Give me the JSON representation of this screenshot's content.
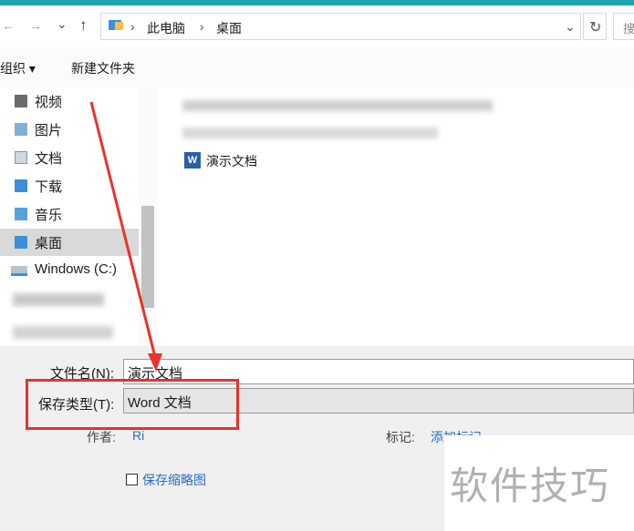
{
  "nav": {
    "back_icon": "←",
    "forward_icon": "→",
    "dropdown_icon": "⌄",
    "up_icon": "↑",
    "breadcrumb": [
      "此电脑",
      "桌面"
    ],
    "sep": "›",
    "refresh_icon": "↻",
    "search_fragment": "搜"
  },
  "toolbar": {
    "organize": "组织 ▾",
    "new_folder": "新建文件夹"
  },
  "sidebar": {
    "items": [
      {
        "label": "视频"
      },
      {
        "label": "图片"
      },
      {
        "label": "文档"
      },
      {
        "label": "下载"
      },
      {
        "label": "音乐"
      },
      {
        "label": "桌面"
      },
      {
        "label": "Windows (C:)"
      }
    ]
  },
  "files": [
    {
      "name": "演示文档",
      "icon": "word-doc-icon"
    }
  ],
  "form": {
    "filename_label": "文件名(N):",
    "filename_value": "演示文档",
    "type_label": "保存类型(T):",
    "type_value": "Word 文档",
    "author_label": "作者:",
    "author_value": "Ri",
    "tags_label": "标记:",
    "tags_value": "添加标记",
    "thumbnail_label": "保存缩略图"
  },
  "watermark": "软件技巧",
  "colors": {
    "accent": "#1aa6b0",
    "annotation": "#e8322d",
    "link": "#2b6cc4"
  }
}
